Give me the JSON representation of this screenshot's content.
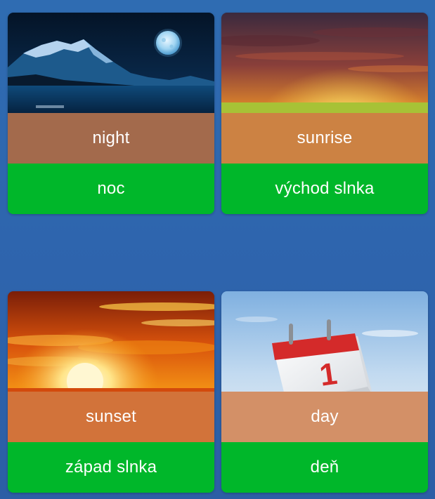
{
  "cards": [
    {
      "word": "night",
      "translation": "noc",
      "image_icon": "night-moon-lake-image"
    },
    {
      "word": "sunrise",
      "translation": "východ slnka",
      "image_icon": "sunrise-field-image"
    },
    {
      "word": "sunset",
      "translation": "západ slnka",
      "image_icon": "sunset-clouds-image"
    },
    {
      "word": "day",
      "translation": "deň",
      "image_icon": "calendar-page-one-image"
    }
  ],
  "colors": {
    "background": "#2e66ae",
    "translation_bar": "#00b72a",
    "caption_overlay": "#cd7846",
    "text": "#ffffff"
  }
}
